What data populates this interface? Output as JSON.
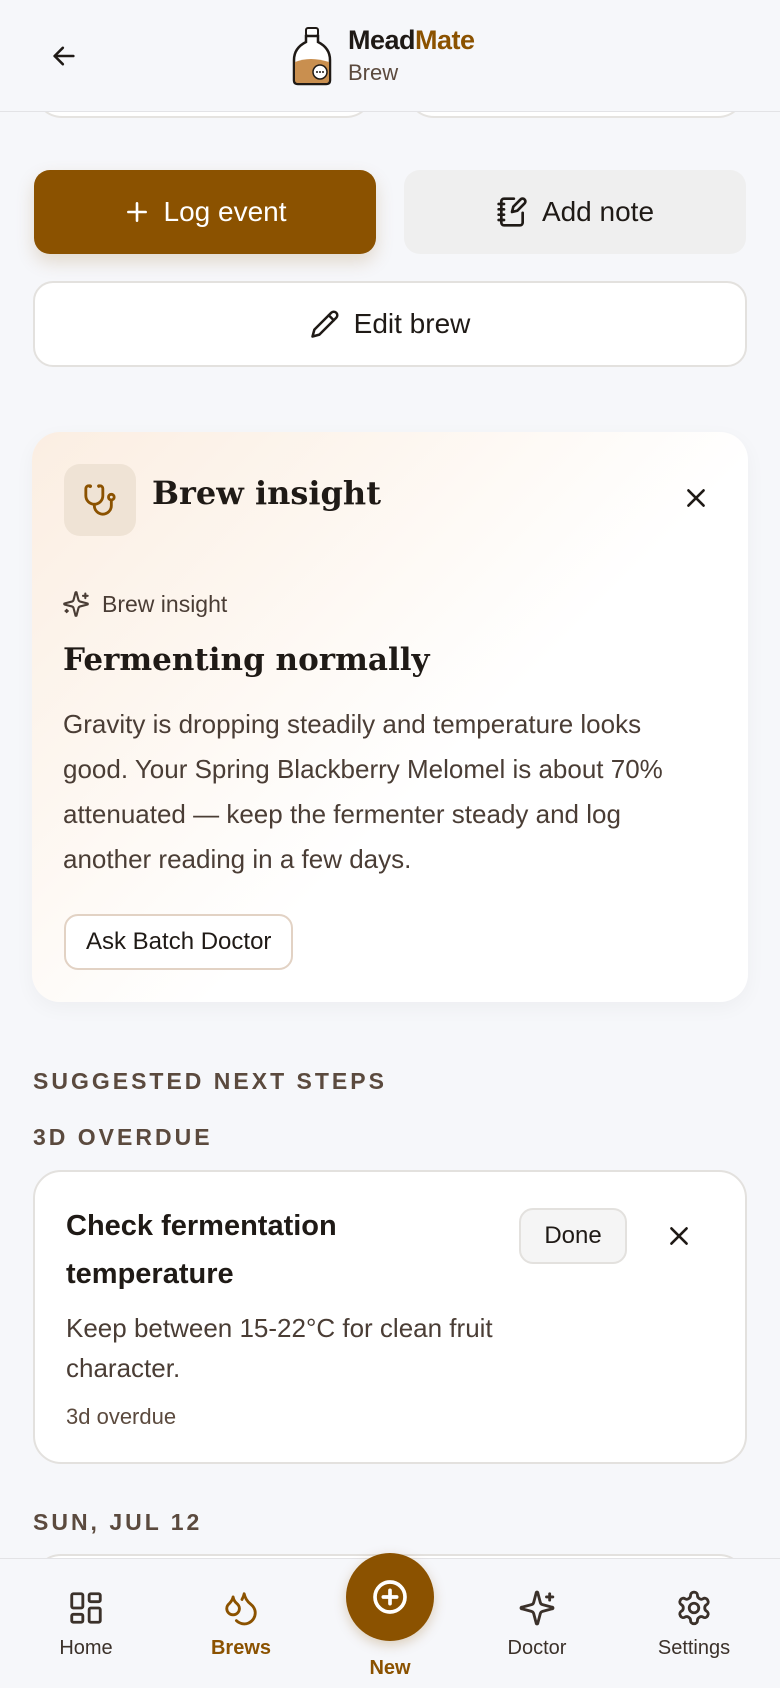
{
  "header": {
    "brand_first": "Mead",
    "brand_second": "Mate",
    "subtitle": "Brew"
  },
  "actions": {
    "log_event": "Log event",
    "add_note": "Add note",
    "edit_brew": "Edit brew"
  },
  "insight": {
    "title": "Brew insight",
    "tag": "Brew insight",
    "heading": "Fermenting normally",
    "body": "Gravity is dropping steadily and temperature looks good. Your Spring Blackberry Melomel is about 70% attenuated — keep the fermenter steady and log another reading in a few days.",
    "ask_button": "Ask Batch Doctor"
  },
  "next_steps": {
    "section_label": "SUGGESTED NEXT STEPS",
    "group_label": "3D OVERDUE",
    "item": {
      "title": "Check fermentation temperature",
      "description": "Keep between 15-22°C for clean fruit character.",
      "meta": "3d overdue",
      "done_label": "Done"
    },
    "next_group_label": "SUN, JUL 12"
  },
  "nav": {
    "home": "Home",
    "brews": "Brews",
    "new": "New",
    "doctor": "Doctor",
    "settings": "Settings"
  },
  "colors": {
    "accent": "#8b5200",
    "background": "#f6f7fa"
  }
}
